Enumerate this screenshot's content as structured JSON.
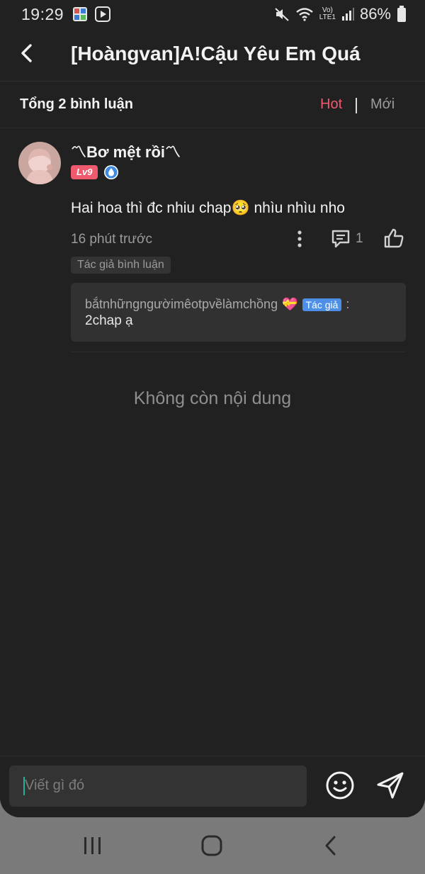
{
  "status_bar": {
    "time": "19:29",
    "battery": "86%",
    "network_label": "Vo)\nLTE1",
    "icons": [
      "notification-app-icon",
      "youtube-icon",
      "mute-icon",
      "wifi-icon",
      "signal-icon",
      "battery-icon"
    ]
  },
  "header": {
    "title": "[Hoàngvan]A!Cậu Yêu Em Quá",
    "back_icon": "chevron-left-icon"
  },
  "comments_bar": {
    "count_label": "Tổng 2 bình luận",
    "sort_hot": "Hot",
    "sort_new": "Mới",
    "active_sort": "Hot",
    "active_color": "#ef5a6f"
  },
  "comment": {
    "username": "〽Bơ mệt rồi〽",
    "level": "Lv9",
    "text": "Hai hoa thì đc nhiu chap🥺 nhìu nhìu nho",
    "time": "16 phút trước",
    "reply_count": "1",
    "author_tag": "Tác giả bình luận",
    "reply": {
      "user": "bắtnhữngngườimêotpvềlàmchồng",
      "author_badge": "Tác giả",
      "colon": ":",
      "text": "2chap ạ"
    }
  },
  "end_label": "Không còn nội dung",
  "input": {
    "placeholder": "Viết gì đó",
    "emoji_icon": "emoji-icon",
    "send_icon": "send-icon"
  },
  "nav": {
    "icons": [
      "recent-apps-icon",
      "home-icon",
      "back-icon"
    ]
  }
}
